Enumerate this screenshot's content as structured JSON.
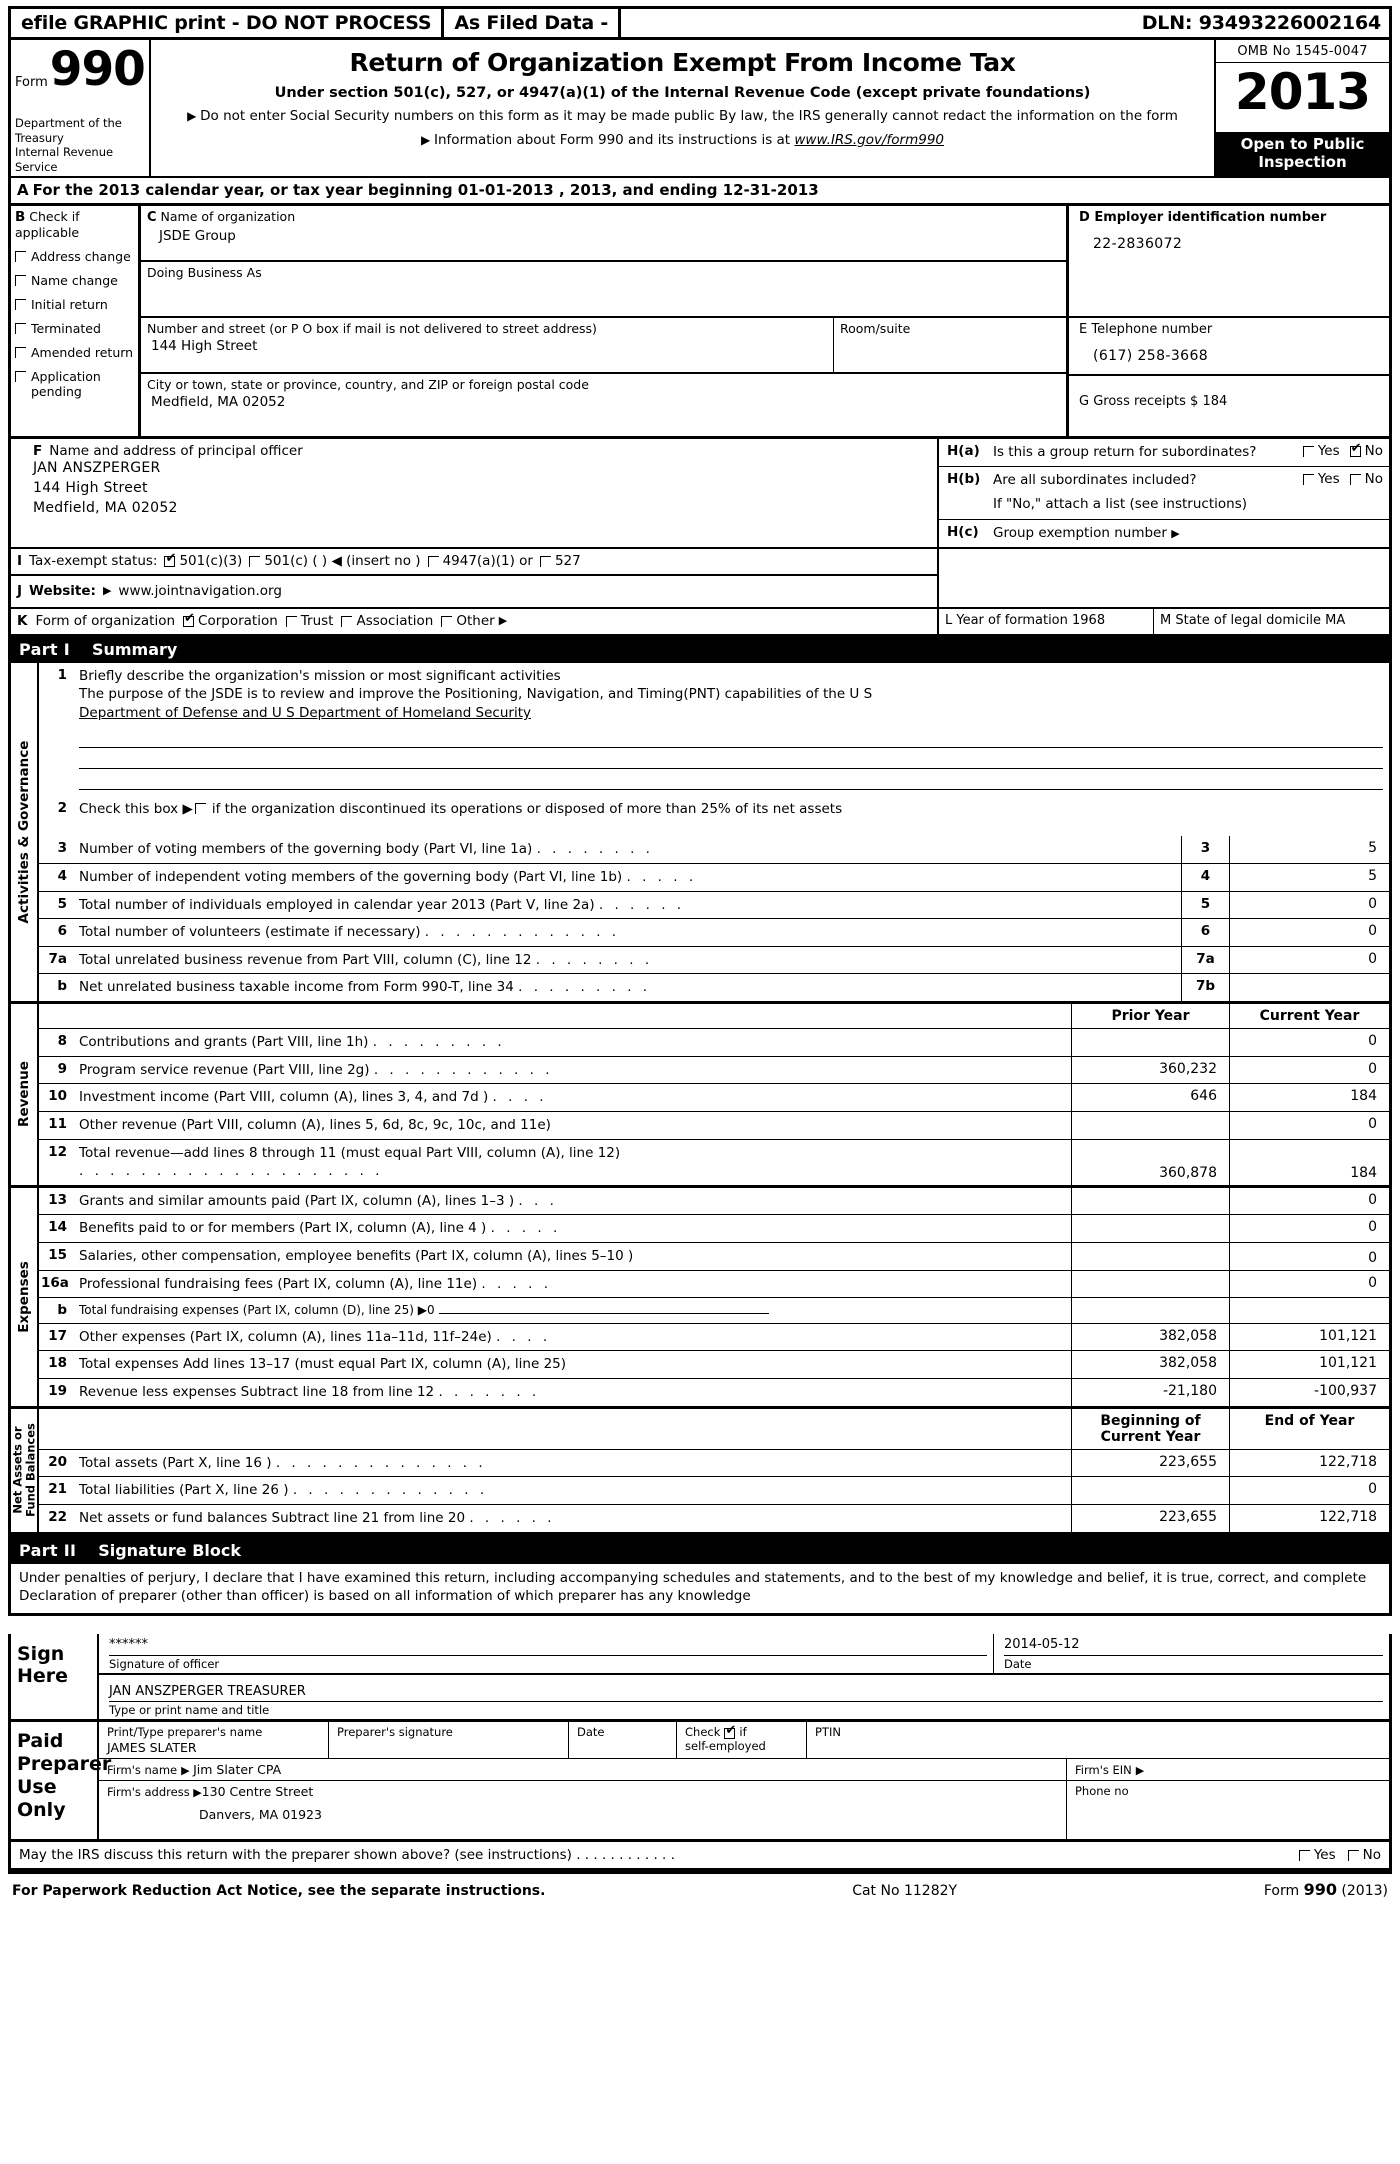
{
  "efile_bar": {
    "left": "efile GRAPHIC print - DO NOT PROCESS",
    "middle": "As Filed Data -",
    "dln": "DLN: 93493226002164"
  },
  "masthead": {
    "form_word": "Form",
    "form_number": "990",
    "department": "Department of the Treasury",
    "agency": "Internal Revenue Service",
    "title": "Return of Organization Exempt From Income Tax",
    "subtitle": "Under section 501(c), 527, or 4947(a)(1) of the Internal Revenue Code (except private foundations)",
    "bullet1": "Do not enter Social Security numbers on this form as it may be made public  By law, the IRS generally cannot redact the information on the form",
    "bullet2_prefix": "Information about Form 990 and its instructions is at ",
    "bullet2_link": "www.IRS.gov/form990",
    "omb": "OMB No  1545-0047",
    "year": "2013",
    "open_to_public": "Open to Public Inspection"
  },
  "line_a": {
    "label": "A",
    "text": "For the 2013 calendar year, or tax year beginning 01-01-2013    , 2013, and ending 12-31-2013"
  },
  "section_b": {
    "label": "B",
    "heading": "Check if applicable",
    "items": [
      {
        "label": "Address change",
        "checked": false
      },
      {
        "label": "Name change",
        "checked": false
      },
      {
        "label": "Initial return",
        "checked": false
      },
      {
        "label": "Terminated",
        "checked": false
      },
      {
        "label": "Amended return",
        "checked": false
      },
      {
        "label": "Application pending",
        "checked": false
      }
    ]
  },
  "section_c": {
    "label": "C",
    "name_caption": "Name of organization",
    "name_value": "JSDE Group",
    "dba_caption": "Doing Business As",
    "dba_value": "",
    "street_caption": "Number and street (or P O  box if mail is not delivered to street address)",
    "street_value": "144 High Street",
    "room_caption": "Room/suite",
    "room_value": "",
    "city_caption": "City or town, state or province, country, and ZIP or foreign postal code",
    "city_value": "Medfield, MA  02052"
  },
  "section_d": {
    "ein_caption": "D Employer identification number",
    "ein_value": "22-2836072",
    "phone_caption": "E Telephone number",
    "phone_value": "(617) 258-3668",
    "gross_caption": "G Gross receipts $ 184"
  },
  "section_f": {
    "label": "F",
    "caption": "Name and address of principal officer",
    "officer_name": "JAN ANSZPERGER",
    "officer_street": "144 High Street",
    "officer_city": "Medfield, MA  02052"
  },
  "section_h": {
    "ha_key": "H(a)",
    "ha_text": "Is this a group return for subordinates?",
    "ha_yes": "Yes",
    "ha_no": "No",
    "ha_yes_checked": false,
    "ha_no_checked": true,
    "hb_key": "H(b)",
    "hb_text": "Are all subordinates included?",
    "hb_yes": "Yes",
    "hb_no": "No",
    "hb_yes_checked": false,
    "hb_no_checked": false,
    "hb_note": "If \"No,\" attach a list  (see instructions)",
    "hc_key": "H(c)",
    "hc_text": "Group exemption number"
  },
  "section_i": {
    "label": "I",
    "caption": "Tax-exempt status:",
    "options": [
      {
        "label": "501(c)(3)",
        "checked": true
      },
      {
        "label": "501(c) (  ) ◀ (insert no )",
        "checked": false
      },
      {
        "label": "4947(a)(1) or",
        "checked": false
      },
      {
        "label": "527",
        "checked": false
      }
    ]
  },
  "section_j": {
    "label": "J",
    "caption": "Website:",
    "value": "www.jointnavigation.org"
  },
  "section_k": {
    "label": "K",
    "caption": "Form of organization",
    "options": [
      {
        "label": "Corporation",
        "checked": true
      },
      {
        "label": "Trust",
        "checked": false
      },
      {
        "label": "Association",
        "checked": false
      },
      {
        "label": "Other",
        "checked": false
      }
    ],
    "l_label": "L Year of formation  1968",
    "m_label": "M State of legal domicile  MA"
  },
  "part1": {
    "part_label": "Part I",
    "part_title": "Summary",
    "sidebar_top": "Activities & Governance",
    "sidebar_rev": "Revenue",
    "sidebar_exp": "Expenses",
    "sidebar_net": "Net Assets or Fund Balances",
    "line1_num": "1",
    "line1_text": "Briefly describe the organization's mission or most significant activities",
    "line1_value_a": "The purpose of the JSDE is to review and improve the Positioning, Navigation, and Timing(PNT) capabilities of the U S",
    "line1_value_b": "Department of Defense and U S  Department of Homeland Security",
    "line2_num": "2",
    "line2_text": "Check this box ▶",
    "line2_text_rest": "if the organization discontinued its operations or disposed of more than 25% of its net assets",
    "line2_checked": false,
    "col_prior": "Prior Year",
    "col_current": "Current Year",
    "col_begin": "Beginning of Current Year",
    "col_end": "End of Year",
    "governance_rows": [
      {
        "num": "3",
        "text": "Number of voting members of the governing body (Part VI, line 1a)",
        "dots": ". . . . . . . .",
        "box": "3",
        "value": "5"
      },
      {
        "num": "4",
        "text": "Number of independent voting members of the governing body (Part VI, line 1b)",
        "dots": ". . . . .",
        "box": "4",
        "value": "5"
      },
      {
        "num": "5",
        "text": "Total number of individuals employed in calendar year 2013 (Part V, line 2a)",
        "dots": ". . . . . .",
        "box": "5",
        "value": "0"
      },
      {
        "num": "6",
        "text": "Total number of volunteers (estimate if necessary)",
        "dots": ". . . . . . . . . . . . .",
        "box": "6",
        "value": "0"
      },
      {
        "num": "7a",
        "text": "Total unrelated business revenue from Part VIII, column (C), line 12",
        "dots": ". . . . . . . .",
        "box": "7a",
        "value": "0"
      },
      {
        "num": "b",
        "text": "Net unrelated business taxable income from Form 990-T, line 34",
        "dots": ". . . . . . . . .",
        "box": "7b",
        "value": ""
      }
    ],
    "revenue_rows": [
      {
        "num": "8",
        "text": "Contributions and grants (Part VIII, line 1h)",
        "dots": ". . . . . . . . .",
        "prior": "",
        "current": "0"
      },
      {
        "num": "9",
        "text": "Program service revenue (Part VIII, line 2g)",
        "dots": ". . . . . . . . . . . .",
        "prior": "360,232",
        "current": "0"
      },
      {
        "num": "10",
        "text": "Investment income (Part VIII, column (A), lines 3, 4, and 7d )",
        "dots": ". . . .",
        "prior": "646",
        "current": "184"
      },
      {
        "num": "11",
        "text": "Other revenue (Part VIII, column (A), lines 5, 6d, 8c, 9c, 10c, and 11e)",
        "dots": "",
        "prior": "",
        "current": "0"
      },
      {
        "num": "12",
        "text": "Total revenue—add lines 8 through 11 (must equal Part VIII, column (A), line 12)",
        "dots": ". . . . . . . . . . . . . . . . . . . .",
        "prior": "360,878",
        "current": "184"
      }
    ],
    "expense_rows": [
      {
        "num": "13",
        "text": "Grants and similar amounts paid (Part IX, column (A), lines 1–3 )",
        "dots": ". . .",
        "prior": "",
        "current": "0"
      },
      {
        "num": "14",
        "text": "Benefits paid to or for members (Part IX, column (A), line 4 )",
        "dots": ". . . . .",
        "prior": "",
        "current": "0"
      },
      {
        "num": "15",
        "text": "Salaries, other compensation, employee benefits (Part IX, column (A), lines 5–10 )",
        "dots": "",
        "prior": "",
        "current": "0"
      },
      {
        "num": "16a",
        "text": "Professional fundraising fees (Part IX, column (A), line 11e)",
        "dots": ". . . . .",
        "prior": "",
        "current": "0"
      },
      {
        "num": "b",
        "text": "Total fundraising expenses (Part IX, column (D), line 25) ▶0",
        "dots": "",
        "prior": "",
        "current": "",
        "is_sub": true
      },
      {
        "num": "17",
        "text": "Other expenses (Part IX, column (A), lines 11a–11d, 11f–24e)",
        "dots": ". . . .",
        "prior": "382,058",
        "current": "101,121"
      },
      {
        "num": "18",
        "text": "Total expenses  Add lines 13–17 (must equal Part IX, column (A), line 25)",
        "dots": "",
        "prior": "382,058",
        "current": "101,121"
      },
      {
        "num": "19",
        "text": "Revenue less expenses  Subtract line 18 from line 12",
        "dots": ". . . . . . .",
        "prior": "-21,180",
        "current": "-100,937"
      }
    ],
    "netasset_rows": [
      {
        "num": "20",
        "text": "Total assets (Part X, line 16 )",
        "dots": ". . . . . . . . . . . . . .",
        "prior": "223,655",
        "current": "122,718"
      },
      {
        "num": "21",
        "text": "Total liabilities (Part X, line 26 )",
        "dots": ". . . . . . . . . . . . .",
        "prior": "",
        "current": "0"
      },
      {
        "num": "22",
        "text": "Net assets or fund balances  Subtract line 21 from line 20",
        "dots": ". . . . . .",
        "prior": "223,655",
        "current": "122,718"
      }
    ]
  },
  "part2": {
    "part_label": "Part II",
    "part_title": "Signature Block",
    "perjury": "Under penalties of perjury, I declare that I have examined this return, including accompanying schedules and statements, and to the best of my knowledge and belief, it is true, correct, and complete  Declaration of preparer (other than officer) is based on all information of which preparer has any knowledge",
    "sign_label": "Sign Here",
    "sig_officer_value": "******",
    "sig_officer_caption": "Signature of officer",
    "sig_date_value": "2014-05-12",
    "sig_date_caption": "Date",
    "sig_name_value": "JAN ANSZPERGER  TREASURER",
    "sig_name_caption": "Type or print name and title",
    "paid_label": "Paid Preparer Use Only",
    "prep_name_caption": "Print/Type preparer's name",
    "prep_name_value": "JAMES SLATER",
    "prep_sig_caption": "Preparer's signature",
    "prep_sig_value": "",
    "prep_date_caption": "Date",
    "prep_date_value": "",
    "prep_check_caption": "Check",
    "prep_check_if": "if",
    "prep_check_self": "self-employed",
    "prep_check_checked": true,
    "ptin_caption": "PTIN",
    "ptin_value": "",
    "firm_name_caption": "Firm's name",
    "firm_name_value": "Jim Slater CPA",
    "firm_ein_caption": "Firm's EIN",
    "firm_ein_value": "",
    "firm_addr_caption": "Firm's address",
    "firm_addr_value": "130 Centre Street",
    "firm_addr_value2": "Danvers, MA  01923",
    "phone_caption": "Phone no",
    "phone_value": "",
    "irs_question": "May the IRS discuss this return with the preparer shown above? (see instructions)",
    "irs_dots": ". . . . . . . . . . . .",
    "irs_yes": "Yes",
    "irs_no": "No",
    "irs_yes_checked": false,
    "irs_no_checked": false
  },
  "footer": {
    "left": "For Paperwork Reduction Act Notice, see the separate instructions.",
    "center": "Cat No 11282Y",
    "right_prefix": "Form ",
    "right_bold": "990",
    "right_suffix": " (2013)"
  }
}
